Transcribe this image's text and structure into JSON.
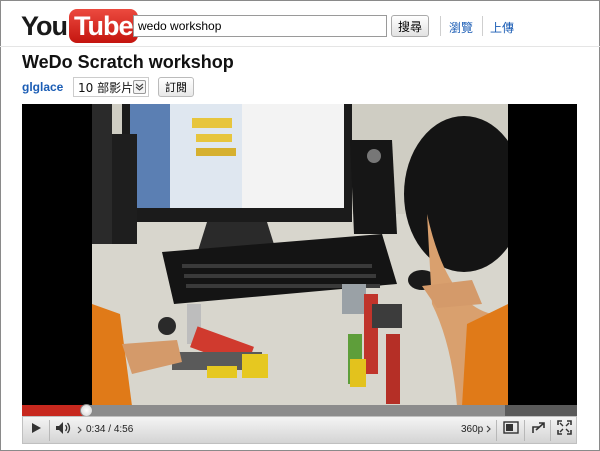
{
  "header": {
    "logo_you": "You",
    "logo_tube": "Tube",
    "search_value": "wedo workshop",
    "search_button": "搜尋",
    "nav": [
      "瀏覽",
      "上傳"
    ]
  },
  "video_page": {
    "title": "WeDo Scratch workshop",
    "channel": "glglace",
    "video_count": "10 部影片",
    "subscribe": "訂閱"
  },
  "player": {
    "current_time": "0:34",
    "duration": "4:56",
    "time_sep": " / ",
    "quality": "360p",
    "played_fraction": 0.115,
    "loaded_fraction": 0.87,
    "accent": "#c7281e"
  },
  "icons": [
    "play-icon",
    "volume-icon",
    "quality-menu-icon",
    "theater-mode-icon",
    "popout-icon",
    "fullscreen-icon",
    "dropdown-chevron-icon"
  ]
}
